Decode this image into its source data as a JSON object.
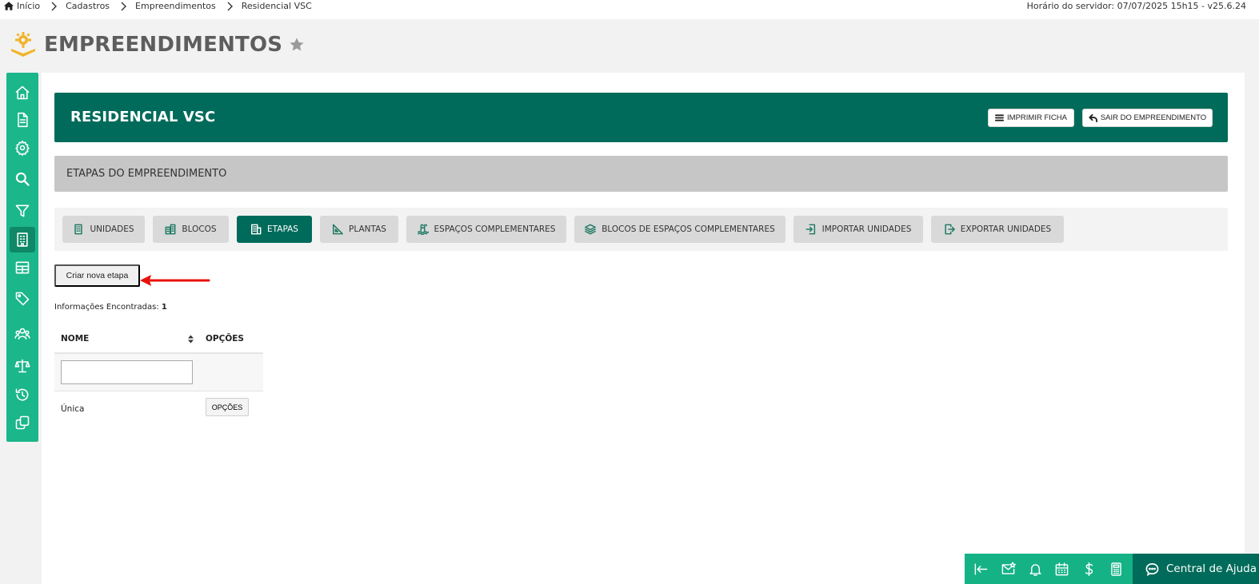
{
  "breadcrumb": {
    "items": [
      "Início",
      "Cadastros",
      "Empreendimentos",
      "Residencial VSC"
    ],
    "server_time": "Horário do servidor: 07/07/2025 15h15 - v25.6.24"
  },
  "page": {
    "title": "EMPREENDIMENTOS"
  },
  "sidebar": {
    "items": [
      {
        "icon": "home-icon",
        "active": false
      },
      {
        "icon": "document-icon",
        "active": false
      },
      {
        "icon": "gear-icon",
        "active": false
      },
      {
        "icon": "search-icon",
        "active": false
      },
      {
        "icon": "filter-icon",
        "active": false
      },
      {
        "icon": "building-icon",
        "active": true
      },
      {
        "icon": "table-icon",
        "active": false
      },
      {
        "icon": "tag-icon",
        "active": false
      },
      {
        "icon": "users-icon",
        "active": false
      },
      {
        "icon": "scale-icon",
        "active": false
      },
      {
        "icon": "history-icon",
        "active": false
      },
      {
        "icon": "copy-icon",
        "active": false
      }
    ]
  },
  "banner": {
    "title": "RESIDENCIAL VSC",
    "print_label": "IMPRIMIR FICHA",
    "exit_label": "SAIR DO EMPREENDIMENTO"
  },
  "section": {
    "title": "ETAPAS DO EMPREENDIMENTO"
  },
  "tabs": [
    {
      "label": "UNIDADES",
      "icon": "building-icon",
      "active": false
    },
    {
      "label": "BLOCOS",
      "icon": "buildings-icon",
      "active": false
    },
    {
      "label": "ETAPAS",
      "icon": "building-icon",
      "active": true
    },
    {
      "label": "PLANTAS",
      "icon": "set-square-icon",
      "active": false
    },
    {
      "label": "ESPAÇOS COMPLEMENTARES",
      "icon": "pool-icon",
      "active": false
    },
    {
      "label": "BLOCOS DE ESPAÇOS COMPLEMENTARES",
      "icon": "layers-icon",
      "active": false
    },
    {
      "label": "IMPORTAR UNIDADES",
      "icon": "import-icon",
      "active": false
    },
    {
      "label": "EXPORTAR UNIDADES",
      "icon": "export-icon",
      "active": false
    }
  ],
  "actions": {
    "create_label": "Criar nova etapa"
  },
  "results": {
    "label": "Informações Encontradas:",
    "count": "1"
  },
  "table": {
    "columns": [
      "NOME",
      "OPÇÕES"
    ],
    "filter": {
      "value": "",
      "placeholder": ""
    },
    "rows": [
      {
        "name": "Única",
        "options_label": "OPÇÕES"
      }
    ]
  },
  "bottombar": {
    "icons": [
      "collapse-left-icon",
      "mail-star-icon",
      "bell-icon",
      "calendar-icon",
      "dollar-icon",
      "calculator-icon"
    ],
    "help_label": "Central de Ajuda"
  },
  "colors": {
    "brand_dark": "#006b5a",
    "brand_light": "#1bb68a",
    "annotation_arrow": "#e8120c",
    "logo": "#f0b429"
  }
}
